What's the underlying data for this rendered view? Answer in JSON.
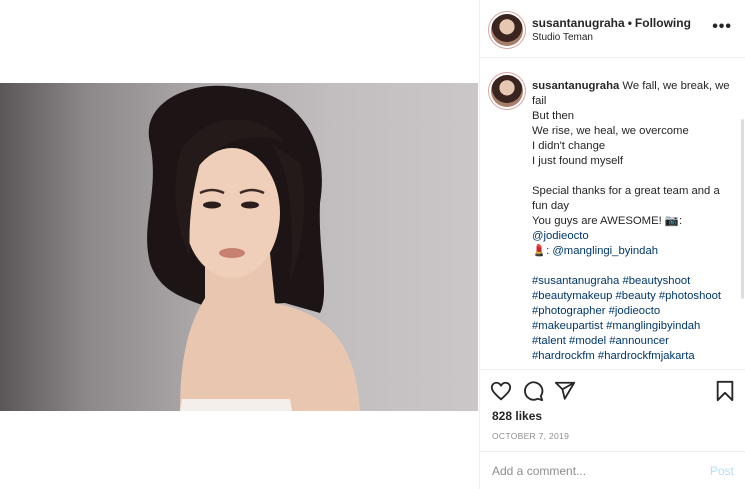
{
  "post": {
    "username": "susantanugraha",
    "dot": "•",
    "follow_status": "Following",
    "location": "Studio Teman",
    "more_icon": "•••"
  },
  "caption": {
    "username": "susantanugraha",
    "lines": [
      "We fall, we break, we fail",
      "But then",
      "We rise, we heal, we overcome",
      "I didn't change",
      "I just found myself",
      "",
      "Special thanks for a great team and a fun day",
      "You guys are AWESOME! 📷:",
      "@jodieocto",
      "💄: @manglingi_byindah",
      "",
      "#susantanugraha #beautyshoot",
      "#beautymakeup #beauty #photoshoot",
      "#photographer #jodieocto",
      "#makeupartist #manglingibyindah",
      "#talent #model #announcer",
      "#hardrockfm #hardrockfmjakarta"
    ]
  },
  "engagement": {
    "likes": "828 likes",
    "date": "OCTOBER 7, 2019"
  },
  "comment_box": {
    "placeholder": "Add a comment...",
    "post_label": "Post"
  },
  "colors": {
    "link": "#00376b",
    "post_disabled": "#b2dffc",
    "muted": "#8e8e8e"
  }
}
